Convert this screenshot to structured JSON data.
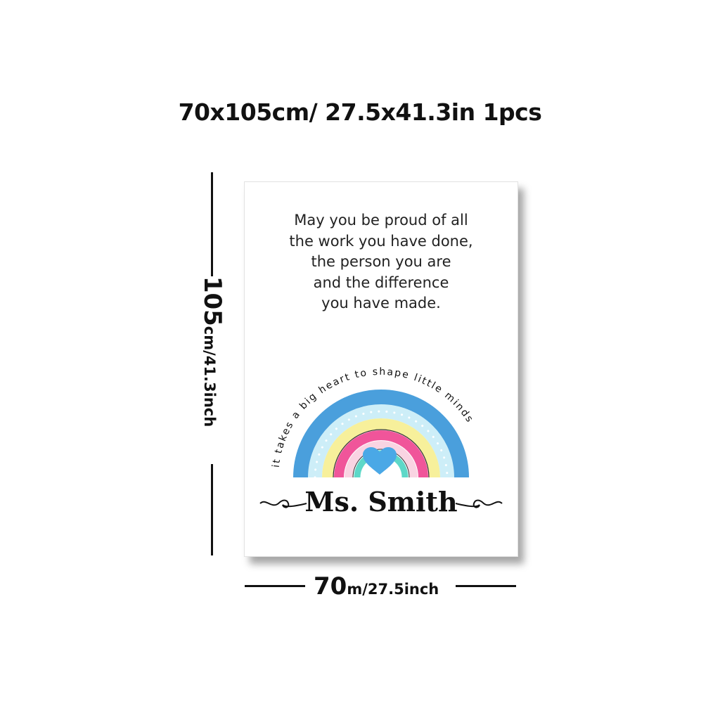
{
  "header": {
    "size_text": "70x105cm/ 27.5x41.3in 1pcs"
  },
  "height_dimension": {
    "value": "105",
    "unit": "cm/41.3inch"
  },
  "width_dimension": {
    "value": "70",
    "unit": "m/27.5inch"
  },
  "poster": {
    "quote_lines": [
      "May you be proud of all",
      "the work you have done,",
      "the person you are",
      "and the difference",
      "you have made."
    ],
    "arc_text": "it takes a big heart to shape little minds",
    "name": "Ms. Smith",
    "colors": {
      "blue": "#4a9fdc",
      "light_blue": "#cdeef8",
      "yellow": "#f7f09b",
      "pink": "#f0559a",
      "light_pink": "#f9d4e2",
      "teal": "#5ed8c8",
      "heart": "#4aa8e6"
    }
  }
}
